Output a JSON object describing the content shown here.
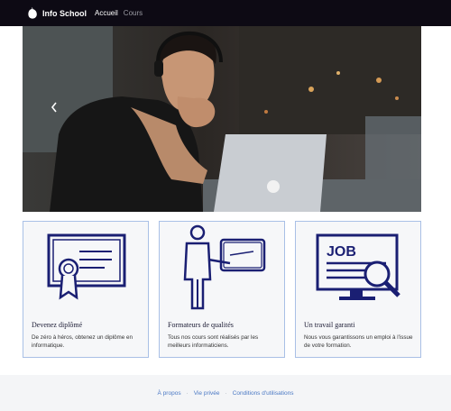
{
  "navbar": {
    "brand": "Info School",
    "links": [
      "Accueil",
      "Cours"
    ]
  },
  "hero": {
    "prev_icon": "chevron-left-icon"
  },
  "cards": [
    {
      "title": "Devenez diplômé",
      "text": "De zéro à héros, obtenez un diplôme en informatique."
    },
    {
      "title": "Formateurs de qualités",
      "text": "Tous nos cours sont réalisés par les meilleurs informaticiens."
    },
    {
      "title": "Un travail garanti",
      "text": "Nous vous garantissons un emploi à l'issue de votre formation."
    }
  ],
  "icon_text": {
    "job": "JOB"
  },
  "footer": {
    "links": [
      "À propos",
      "Vie privée",
      "Conditions d'utilisations"
    ],
    "separator": "·"
  },
  "colors": {
    "navbar_bg": "#0d0a14",
    "icon_navy": "#1a1f73",
    "link_blue": "#4a78c4",
    "card_border": "#a9c0e6"
  }
}
